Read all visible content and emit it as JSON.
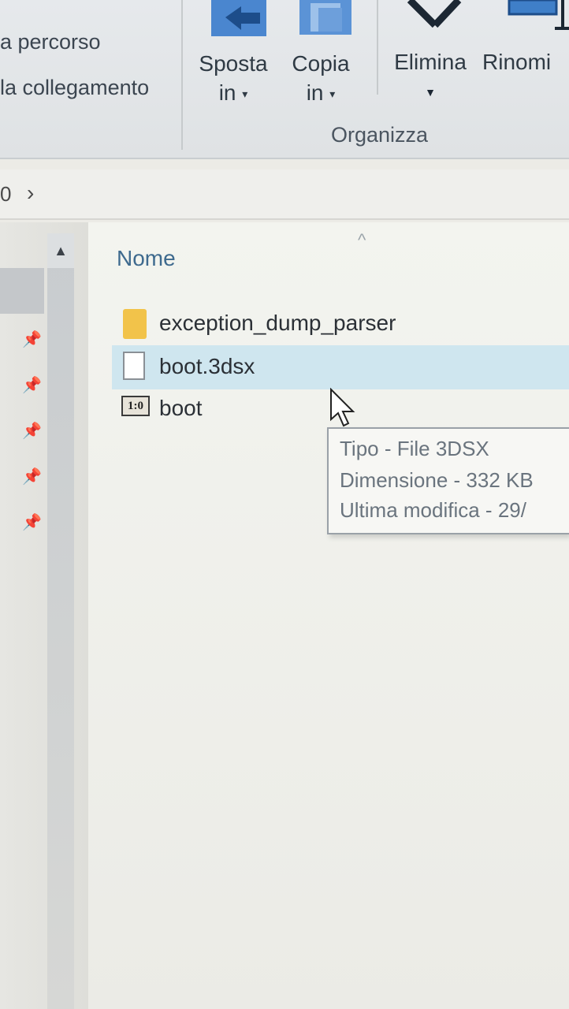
{
  "ribbon": {
    "left_items": [
      "a percorso",
      "la collegamento"
    ],
    "buttons": [
      {
        "label_top": "Sposta",
        "label_bottom": "in",
        "icon": "move-to-icon"
      },
      {
        "label_top": "Copia",
        "label_bottom": "in",
        "icon": "copy-to-icon"
      },
      {
        "label": "Elimina",
        "icon": "delete-icon"
      },
      {
        "label": "Rinomi",
        "icon": "rename-icon"
      }
    ],
    "group_label": "Organizza"
  },
  "address_bar": {
    "crumb": "0",
    "separator": "›"
  },
  "file_list": {
    "column_header": "Nome",
    "items": [
      {
        "name": "exception_dump_parser",
        "icon": "folder-icon"
      },
      {
        "name": "boot.3dsx",
        "icon": "file-icon",
        "selected": true
      },
      {
        "name": "boot",
        "icon": "binary-file-icon",
        "icon_text": "1:0"
      }
    ]
  },
  "tooltip": {
    "type": "Tipo - File 3DSX",
    "size": "Dimensione - 332 KB",
    "modified": "Ultima modifica - 29/"
  },
  "colors": {
    "selection": "#cfe6ef",
    "folder": "#f2c34a",
    "header_text": "#3e6a8e",
    "ribbon_icon": "#3f7fc8"
  }
}
